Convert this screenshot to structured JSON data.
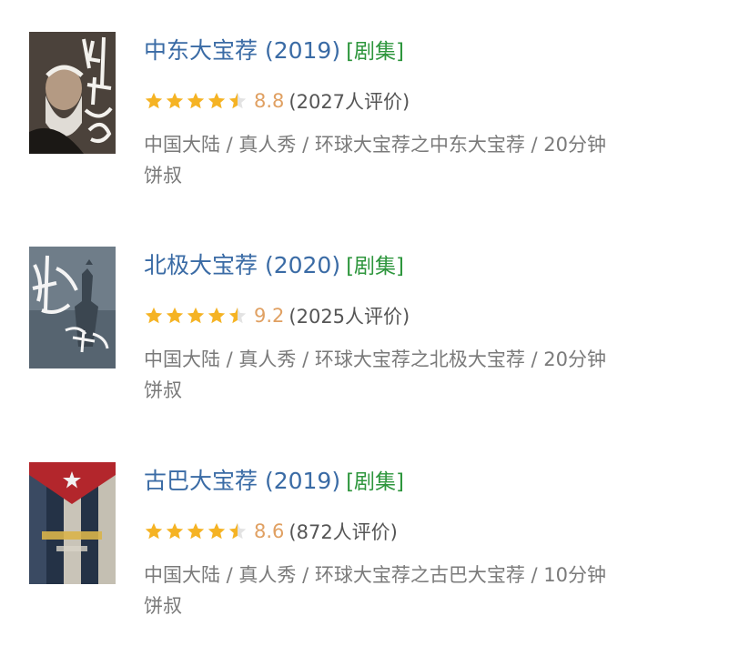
{
  "items": [
    {
      "title": "中东大宝荐 (2019)",
      "badge": "[剧集]",
      "score": "8.8",
      "votes": "(2027人评价)",
      "stars": 4.5,
      "meta_line1": "中国大陆 / 真人秀 / 环球大宝荐之中东大宝荐 / 20分钟",
      "meta_line2": "饼叔",
      "poster_icon": "bearded-man-poster-icon"
    },
    {
      "title": "北极大宝荐 (2020)",
      "badge": "[剧集]",
      "score": "9.2",
      "votes": "(2025人评价)",
      "stars": 4.5,
      "meta_line1": "中国大陆 / 真人秀 / 环球大宝荐之北极大宝荐 / 20分钟",
      "meta_line2": "饼叔",
      "poster_icon": "arctic-statue-poster-icon"
    },
    {
      "title": "古巴大宝荐 (2019)",
      "badge": "[剧集]",
      "score": "8.6",
      "votes": "(872人评价)",
      "stars": 4.5,
      "meta_line1": "中国大陆 / 真人秀 / 环球大宝荐之古巴大宝荐 / 10分钟",
      "meta_line2": "饼叔",
      "poster_icon": "cuban-flag-poster-icon"
    }
  ],
  "colors": {
    "title": "#3a6ba5",
    "badge": "#2e963d",
    "score": "#e0a062",
    "star": "#f5b324",
    "star_empty": "#e3e3e3",
    "meta": "#7a7a7a"
  }
}
